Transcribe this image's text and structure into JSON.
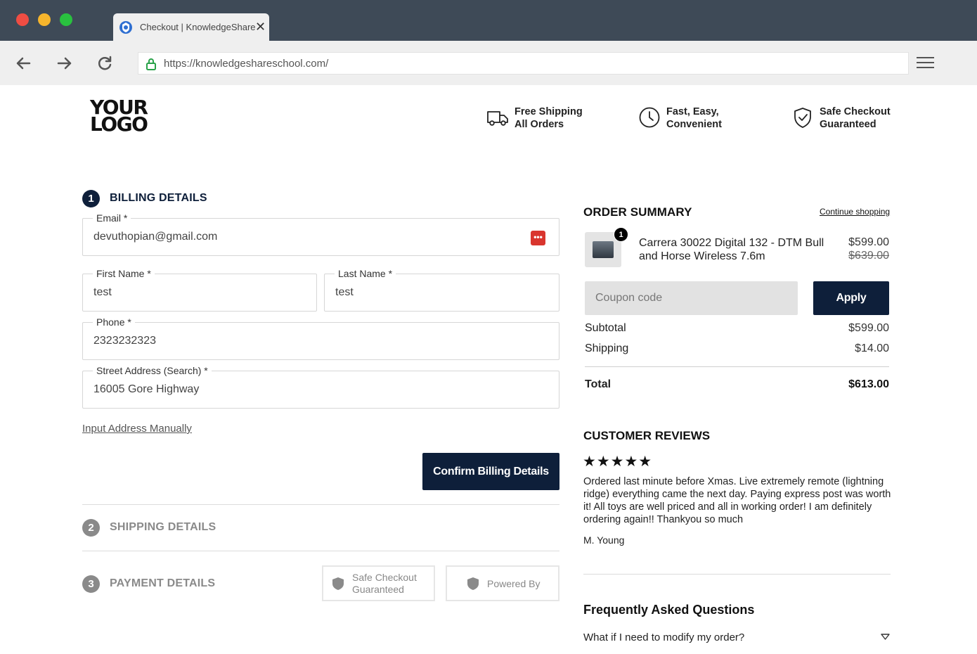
{
  "browser": {
    "tab_title": "Checkout | KnowledgeShare",
    "tab_close": "✕",
    "url": "https://knowledgeshareschool.com/"
  },
  "header": {
    "logo_line1": "YOUR",
    "logo_line2": "LOGO",
    "features": [
      {
        "icon": "truck-icon",
        "line1": "Free Shipping",
        "line2": "All Orders"
      },
      {
        "icon": "clock-icon",
        "line1": "Fast, Easy,",
        "line2": "Convenient"
      },
      {
        "icon": "shield-check-icon",
        "line1": "Safe Checkout",
        "line2": "Guaranteed"
      }
    ]
  },
  "billing": {
    "step": "1",
    "title": "BILLING DETAILS",
    "email": {
      "label": "Email *",
      "value": "devuthopian@gmail.com"
    },
    "first_name": {
      "label": "First Name *",
      "value": "test"
    },
    "last_name": {
      "label": "Last Name *",
      "value": "test"
    },
    "phone": {
      "label": "Phone *",
      "value": "2323232323"
    },
    "address": {
      "label": "Street Address (Search) *",
      "value": "16005 Gore Highway"
    },
    "manual_link": "Input Address Manually",
    "confirm_label": "Confirm Billing Details"
  },
  "shipping": {
    "step": "2",
    "title": "SHIPPING DETAILS"
  },
  "payment": {
    "step": "3",
    "title": "PAYMENT DETAILS",
    "badge1_line1": "Safe Checkout",
    "badge1_line2": "Guaranteed",
    "badge2": "Powered By"
  },
  "summary": {
    "title": "ORDER SUMMARY",
    "continue_link": "Continue shopping",
    "product": {
      "qty": "1",
      "name": "Carrera 30022 Digital 132 - DTM Bull and Horse Wireless 7.6m",
      "price": "$599.00",
      "old_price": "$639.00"
    },
    "coupon_placeholder": "Coupon code",
    "apply_label": "Apply",
    "subtotal_label": "Subtotal",
    "subtotal": "$599.00",
    "shipping_label": "Shipping",
    "shipping": "$14.00",
    "total_label": "Total",
    "total": "$613.00"
  },
  "reviews": {
    "title": "CUSTOMER REVIEWS",
    "rating": 5,
    "stars": "★★★★★",
    "text": "Ordered last minute before Xmas. Live extremely remote (lightning ridge) everything came the next day. Paying express post was worth it! All toys are well priced and all in working order! I am definitely ordering again!! Thankyou so much",
    "author": "M. Young"
  },
  "faq": {
    "title": "Frequently Asked Questions",
    "question": "What if I need to modify my order?"
  },
  "colors": {
    "navy": "#0e1f3a",
    "titlebar": "#3e4a57",
    "step_inactive": "#8a8a8a"
  }
}
